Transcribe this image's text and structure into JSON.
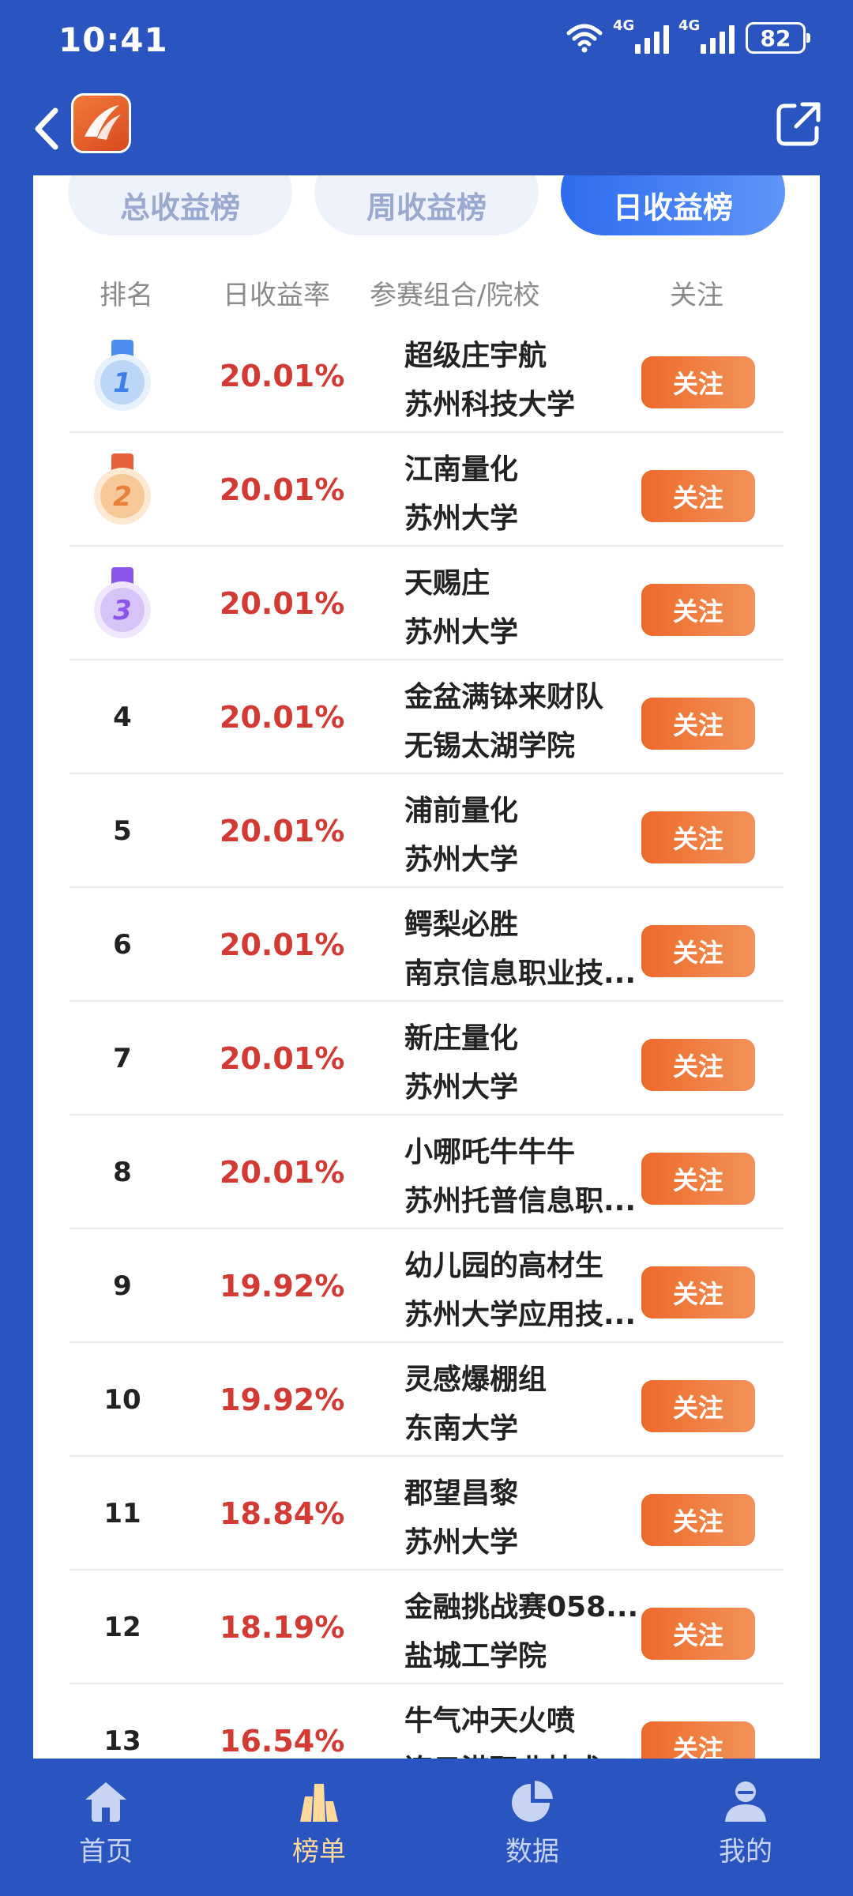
{
  "status": {
    "time": "10:41",
    "net1": "4G",
    "net2": "4G",
    "battery": "82"
  },
  "tabs": [
    "总收益榜",
    "周收益榜",
    "日收益榜"
  ],
  "columns": {
    "rank": "排名",
    "rate": "日收益率",
    "team": "参赛组合/院校",
    "follow": "关注"
  },
  "rows": [
    {
      "rank": "1",
      "rate": "20.01%",
      "team": "超级庄宇航",
      "school": "苏州科技大学",
      "follow": "关注"
    },
    {
      "rank": "2",
      "rate": "20.01%",
      "team": "江南量化",
      "school": "苏州大学",
      "follow": "关注"
    },
    {
      "rank": "3",
      "rate": "20.01%",
      "team": "天赐庄",
      "school": "苏州大学",
      "follow": "关注"
    },
    {
      "rank": "4",
      "rate": "20.01%",
      "team": "金盆满钵来财队",
      "school": "无锡太湖学院",
      "follow": "关注"
    },
    {
      "rank": "5",
      "rate": "20.01%",
      "team": "浦前量化",
      "school": "苏州大学",
      "follow": "关注"
    },
    {
      "rank": "6",
      "rate": "20.01%",
      "team": "鳄梨必胜",
      "school": "南京信息职业技...",
      "follow": "关注"
    },
    {
      "rank": "7",
      "rate": "20.01%",
      "team": "新庄量化",
      "school": "苏州大学",
      "follow": "关注"
    },
    {
      "rank": "8",
      "rate": "20.01%",
      "team": "小哪吒牛牛牛",
      "school": "苏州托普信息职...",
      "follow": "关注"
    },
    {
      "rank": "9",
      "rate": "19.92%",
      "team": "幼儿园的高材生",
      "school": "苏州大学应用技...",
      "follow": "关注"
    },
    {
      "rank": "10",
      "rate": "19.92%",
      "team": "灵感爆棚组",
      "school": "东南大学",
      "follow": "关注"
    },
    {
      "rank": "11",
      "rate": "18.84%",
      "team": "郡望昌黎",
      "school": "苏州大学",
      "follow": "关注"
    },
    {
      "rank": "12",
      "rate": "18.19%",
      "team": "金融挑战赛058...",
      "school": "盐城工学院",
      "follow": "关注"
    },
    {
      "rank": "13",
      "rate": "16.54%",
      "team": "牛气冲天火喷",
      "school": "连云港职业技术",
      "follow": "关注"
    }
  ],
  "nav": [
    {
      "label": "首页",
      "icon": "home-icon"
    },
    {
      "label": "榜单",
      "icon": "ranking-icon"
    },
    {
      "label": "数据",
      "icon": "pie-chart-icon"
    },
    {
      "label": "我的",
      "icon": "user-icon"
    }
  ],
  "colors": {
    "primary": "#2a55c0",
    "accent": "#ee6a2a",
    "rate": "#d23a33"
  }
}
